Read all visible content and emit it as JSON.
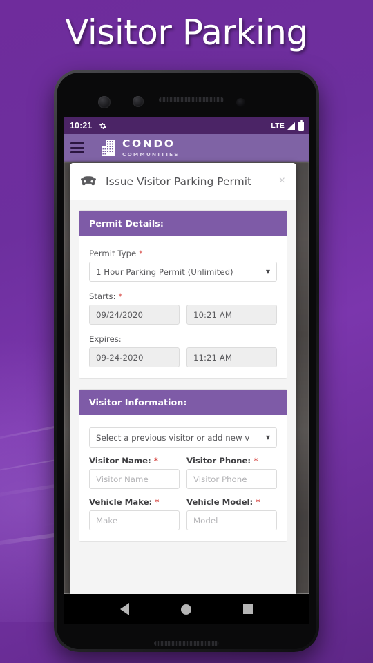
{
  "poster": {
    "title": "Visitor Parking",
    "background_color": "#6f2c9c"
  },
  "phone": {
    "statusbar": {
      "time": "10:21",
      "gear_icon": "gear-icon",
      "network": "LTE",
      "signal_icon": "signal-triangle-icon",
      "battery_icon": "battery-full-icon"
    },
    "appbar": {
      "menu_icon": "hamburger-menu-icon",
      "logo_icon": "condo-building-logo-icon",
      "brand_line1": "CONDO",
      "brand_line2": "COMMUNITIES",
      "background_color": "#7f63a5"
    },
    "navbar": {
      "back": "back-triangle-icon",
      "home": "home-circle-icon",
      "recents": "recents-square-icon"
    }
  },
  "modal": {
    "icon": "car-front-icon",
    "title": "Issue Visitor Parking Permit",
    "close_label": "×",
    "sections": [
      {
        "heading": "Permit Details:",
        "fields": {
          "permit_type_label": "Permit Type",
          "permit_type_required": "*",
          "permit_type_value": "1 Hour Parking Permit (Unlimited)",
          "starts_label": "Starts:",
          "starts_required": "*",
          "starts_date": "09/24/2020",
          "starts_time": "10:21 AM",
          "expires_label": "Expires:",
          "expires_date": "09-24-2020",
          "expires_time": "11:21 AM"
        }
      },
      {
        "heading": "Visitor Information:",
        "fields": {
          "previous_visitor_value": "Select a previous visitor or add new v",
          "visitor_name_label": "Visitor Name:",
          "visitor_name_required": "*",
          "visitor_name_placeholder": "Visitor Name",
          "visitor_phone_label": "Visitor Phone:",
          "visitor_phone_required": "*",
          "visitor_phone_placeholder": "Visitor Phone",
          "vehicle_make_label": "Vehicle Make:",
          "vehicle_make_required": "*",
          "vehicle_make_placeholder": "Make",
          "vehicle_model_label": "Vehicle Model:",
          "vehicle_model_required": "*",
          "vehicle_model_placeholder": "Model"
        }
      }
    ],
    "accent_color": "#7e5ba7"
  }
}
